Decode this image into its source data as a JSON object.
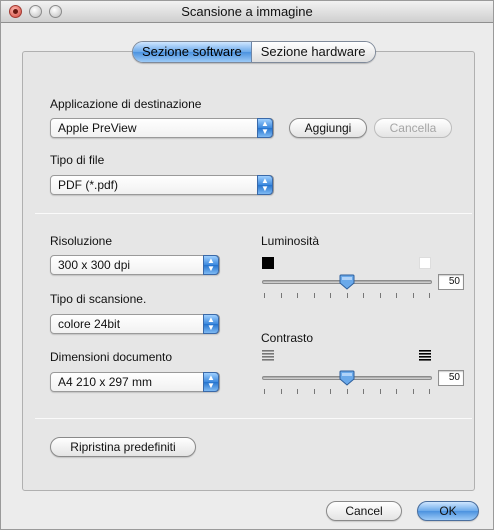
{
  "window": {
    "title": "Scansione a immagine"
  },
  "tabs": [
    {
      "label": "Sezione software",
      "active": true
    },
    {
      "label": "Sezione hardware",
      "active": false
    }
  ],
  "destination": {
    "label": "Applicazione di destinazione",
    "value": "Apple PreView",
    "add_label": "Aggiungi",
    "remove_label": "Cancella"
  },
  "file_type": {
    "label": "Tipo di file",
    "value": "PDF (*.pdf)"
  },
  "resolution": {
    "label": "Risoluzione",
    "value": "300 x 300 dpi"
  },
  "scan_type": {
    "label": "Tipo di scansione.",
    "value": "colore 24bit"
  },
  "doc_size": {
    "label": "Dimensioni documento",
    "value": "A4 210 x 297 mm"
  },
  "brightness": {
    "label": "Luminosità",
    "value": "50",
    "level": 0.5,
    "min_icon": "black-square-icon",
    "max_icon": "white-square-icon"
  },
  "contrast": {
    "label": "Contrasto",
    "value": "50",
    "level": 0.5,
    "min_icon": "low-contrast-icon",
    "max_icon": "high-contrast-icon"
  },
  "reset_label": "Ripristina predefiniti",
  "footer": {
    "cancel_label": "Cancel",
    "ok_label": "OK"
  },
  "colors": {
    "accent": "#4b92df",
    "window_bg": "#ececec"
  }
}
